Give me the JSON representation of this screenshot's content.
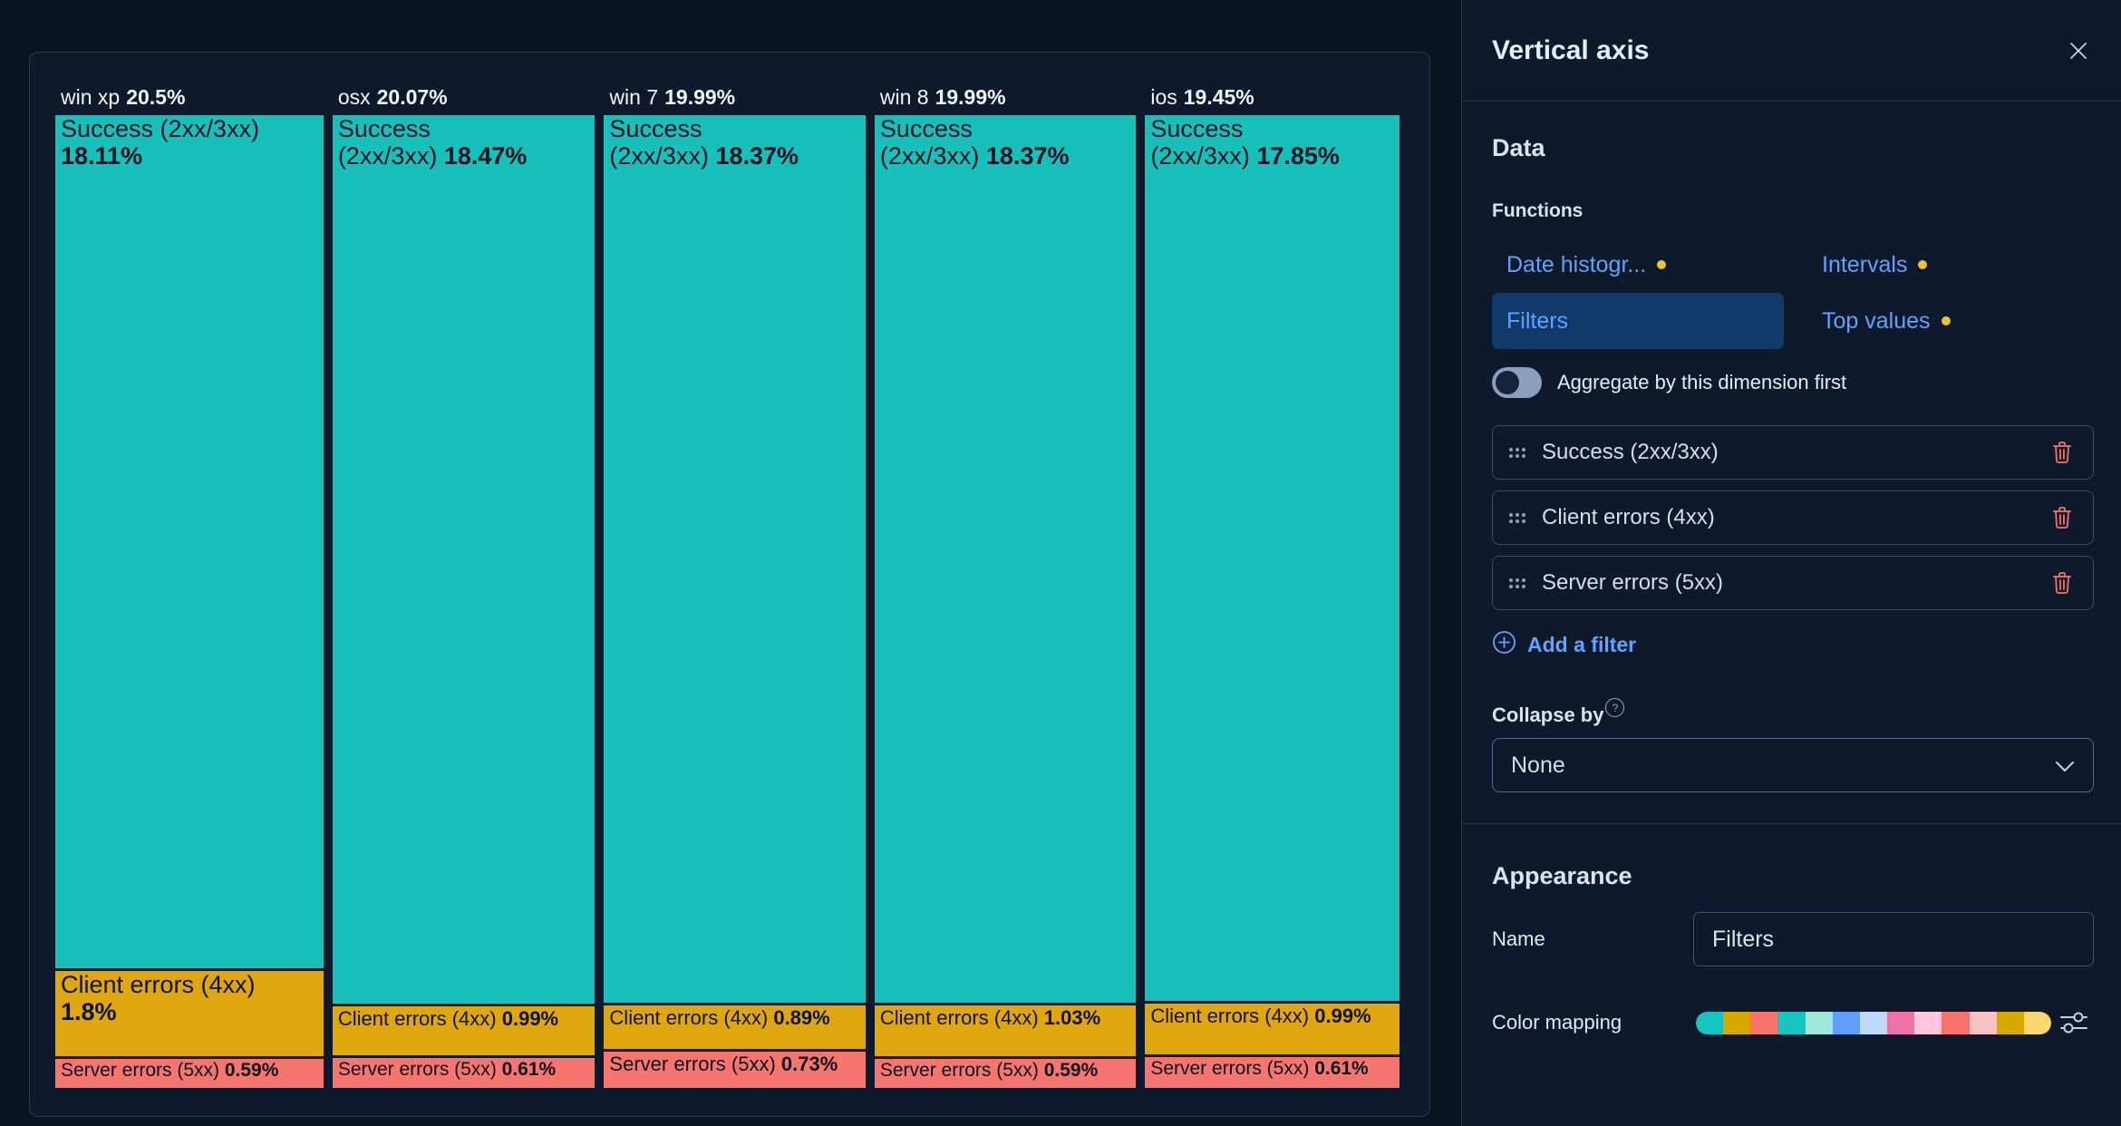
{
  "chart_data": {
    "type": "mosaic",
    "title": "",
    "legend": "none",
    "value_format": "percent",
    "categories": [
      "win xp",
      "osx",
      "win 7",
      "win 8",
      "ios"
    ],
    "column_total_labels": [
      "20.5%",
      "20.07%",
      "19.99%",
      "19.99%",
      "19.45%"
    ],
    "series": [
      {
        "name": "Success (2xx/3xx)",
        "color": "#17C0BA",
        "values": [
          18.11,
          18.47,
          18.37,
          18.37,
          17.85
        ]
      },
      {
        "name": "Client errors (4xx)",
        "color": "#E0A60E",
        "values": [
          1.8,
          0.99,
          0.89,
          1.03,
          0.99
        ]
      },
      {
        "name": "Server errors (5xx)",
        "color": "#F6766F",
        "values": [
          0.59,
          0.61,
          0.73,
          0.59,
          0.61
        ]
      }
    ],
    "columns": [
      {
        "header_t": "win xp",
        "header_b": "20.5%",
        "total": 20.5,
        "cells": [
          {
            "v": 18.11,
            "color": "#17C0BA",
            "cls": "lg",
            "l1t": "Success (2xx/3xx)",
            "l1b": "",
            "l2t": "",
            "l2b": "18.11%"
          },
          {
            "v": 1.8,
            "color": "#E0A60E",
            "cls": "lg",
            "l1t": "Client errors (4xx)",
            "l1b": "",
            "l2t": "",
            "l2b": "1.8%"
          },
          {
            "v": 0.59,
            "color": "#F6766F",
            "cls": "sm",
            "l1t": "Server errors (5xx) ",
            "l1b": "0.59%",
            "l2t": "",
            "l2b": ""
          }
        ]
      },
      {
        "header_t": "osx",
        "header_b": "20.07%",
        "total": 20.07,
        "cells": [
          {
            "v": 18.47,
            "color": "#17C0BA",
            "cls": "lg",
            "l1t": "Success",
            "l1b": "",
            "l2t": "(2xx/3xx) ",
            "l2b": "18.47%"
          },
          {
            "v": 0.99,
            "color": "#E0A60E",
            "cls": "md",
            "l1t": "Client errors (4xx) ",
            "l1b": "0.99%",
            "l2t": "",
            "l2b": ""
          },
          {
            "v": 0.61,
            "color": "#F6766F",
            "cls": "sm",
            "l1t": "Server errors (5xx) ",
            "l1b": "0.61%",
            "l2t": "",
            "l2b": ""
          }
        ]
      },
      {
        "header_t": "win 7",
        "header_b": "19.99%",
        "total": 19.99,
        "cells": [
          {
            "v": 18.37,
            "color": "#17C0BA",
            "cls": "lg",
            "l1t": "Success",
            "l1b": "",
            "l2t": "(2xx/3xx) ",
            "l2b": "18.37%"
          },
          {
            "v": 0.89,
            "color": "#E0A60E",
            "cls": "md",
            "l1t": "Client errors (4xx) ",
            "l1b": "0.89%",
            "l2t": "",
            "l2b": ""
          },
          {
            "v": 0.73,
            "color": "#F6766F",
            "cls": "md",
            "l1t": "Server errors (5xx) ",
            "l1b": "0.73%",
            "l2t": "",
            "l2b": ""
          }
        ]
      },
      {
        "header_t": "win 8",
        "header_b": "19.99%",
        "total": 19.99,
        "cells": [
          {
            "v": 18.37,
            "color": "#17C0BA",
            "cls": "lg",
            "l1t": "Success",
            "l1b": "",
            "l2t": "(2xx/3xx) ",
            "l2b": "18.37%"
          },
          {
            "v": 1.03,
            "color": "#E0A60E",
            "cls": "md",
            "l1t": "Client errors (4xx) ",
            "l1b": "1.03%",
            "l2t": "",
            "l2b": ""
          },
          {
            "v": 0.59,
            "color": "#F6766F",
            "cls": "sm",
            "l1t": "Server errors (5xx) ",
            "l1b": "0.59%",
            "l2t": "",
            "l2b": ""
          }
        ]
      },
      {
        "header_t": "ios",
        "header_b": "19.45%",
        "total": 19.45,
        "cells": [
          {
            "v": 17.85,
            "color": "#17C0BA",
            "cls": "lg",
            "l1t": "Success",
            "l1b": "",
            "l2t": "(2xx/3xx) ",
            "l2b": "17.85%"
          },
          {
            "v": 0.99,
            "color": "#E0A60E",
            "cls": "md",
            "l1t": "Client errors (4xx) ",
            "l1b": "0.99%",
            "l2t": "",
            "l2b": ""
          },
          {
            "v": 0.61,
            "color": "#F6766F",
            "cls": "sm",
            "l1t": "Server errors (5xx) ",
            "l1b": "0.61%",
            "l2t": "",
            "l2b": ""
          }
        ]
      }
    ]
  },
  "flyout": {
    "title": "Vertical axis",
    "data_section": {
      "heading": "Data",
      "functions_label": "Functions",
      "functions": [
        {
          "label": "Date histogr...",
          "dot": true,
          "selected": false
        },
        {
          "label": "Intervals",
          "dot": true,
          "selected": false
        },
        {
          "label": "Filters",
          "dot": false,
          "selected": true
        },
        {
          "label": "Top values",
          "dot": true,
          "selected": false
        }
      ],
      "aggregate_toggle": {
        "label": "Aggregate by this dimension first",
        "state": "off"
      },
      "filters": [
        "Success (2xx/3xx)",
        "Client errors (4xx)",
        "Server errors (5xx)"
      ],
      "add_filter_label": "Add a filter",
      "collapse_by_label": "Collapse by",
      "collapse_by_value": "None"
    },
    "appearance_section": {
      "heading": "Appearance",
      "name_label": "Name",
      "name_value": "Filters",
      "color_mapping_label": "Color mapping",
      "palette": [
        "#16C5C0",
        "#D9A800",
        "#F6726A",
        "#16C5C0",
        "#A0E8DC",
        "#5E9EFF",
        "#BFD9FD",
        "#EE72A6",
        "#FFC7DB",
        "#F6726A",
        "#F8C3C0",
        "#D9A800",
        "#FBD56E"
      ]
    },
    "colors": {
      "accent_blue": "#61A2FF",
      "dot_yellow": "#EFC52E",
      "danger": "#F6726A",
      "chip_bg": "#113A6B"
    }
  }
}
